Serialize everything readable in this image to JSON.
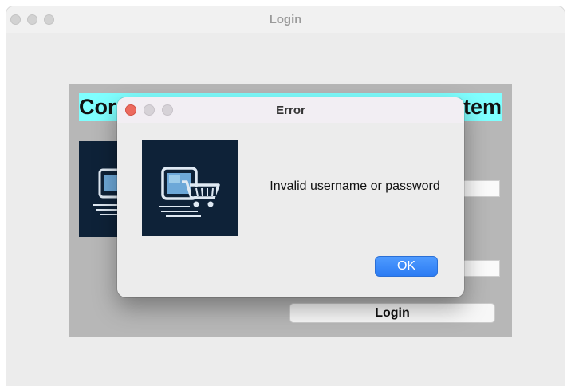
{
  "window": {
    "title": "Login",
    "heading_left": "Cor",
    "heading_right": "tem",
    "login_button": "Login"
  },
  "dialog": {
    "title": "Error",
    "message": "Invalid username or password",
    "ok_button": "OK",
    "icon": "shopping-cart-computer-logo"
  },
  "colors": {
    "heading_bg": "#7fffff",
    "logo_bg": "#0e2238",
    "accent": "#2b7bf3",
    "close_red": "#ec6a5e"
  }
}
